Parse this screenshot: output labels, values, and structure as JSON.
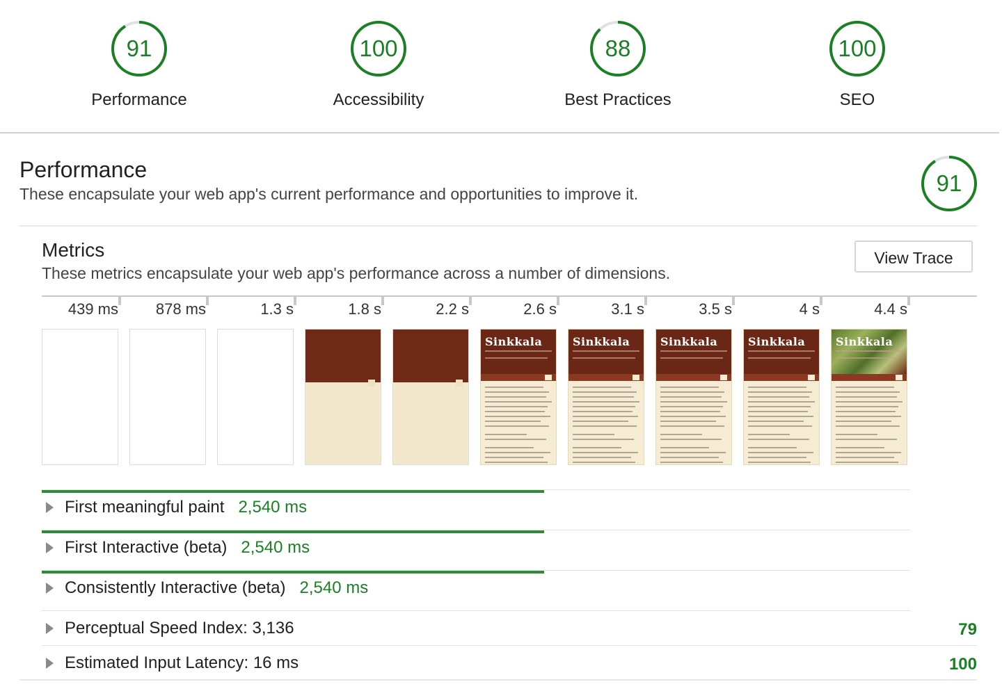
{
  "scores": [
    {
      "value": "91",
      "label": "Performance",
      "fraction": 0.91
    },
    {
      "value": "100",
      "label": "Accessibility",
      "fraction": 1.0
    },
    {
      "value": "88",
      "label": "Best Practices",
      "fraction": 0.88
    },
    {
      "value": "100",
      "label": "SEO",
      "fraction": 1.0
    }
  ],
  "performance": {
    "title": "Performance",
    "description": "These encapsulate your web app's current performance and opportunities to improve it.",
    "score": "91",
    "score_fraction": 0.91
  },
  "metrics": {
    "title": "Metrics",
    "description": "These metrics encapsulate your web app's performance across a number of dimensions.",
    "view_trace_label": "View Trace"
  },
  "filmstrip": {
    "ticks": [
      "439 ms",
      "878 ms",
      "1.3 s",
      "1.8 s",
      "2.2 s",
      "2.6 s",
      "3.1 s",
      "3.5 s",
      "4 s",
      "4.4 s"
    ],
    "frames": [
      "blank",
      "blank",
      "blank",
      "brown",
      "brown",
      "site",
      "site",
      "site",
      "site",
      "site-photo"
    ],
    "site_title": "Sinkkala"
  },
  "rows": [
    {
      "label": "First meaningful paint",
      "value": "2,540 ms",
      "has_bar": true,
      "score": ""
    },
    {
      "label": "First Interactive (beta)",
      "value": "2,540 ms",
      "has_bar": true,
      "score": ""
    },
    {
      "label": "Consistently Interactive (beta)",
      "value": "2,540 ms",
      "has_bar": true,
      "score": ""
    },
    {
      "label": "Perceptual Speed Index: 3,136",
      "value": "",
      "has_bar": false,
      "score": "79"
    },
    {
      "label": "Estimated Input Latency: 16 ms",
      "value": "",
      "has_bar": false,
      "score": "100"
    }
  ],
  "colors": {
    "pass": "#1b7f24",
    "gauge_track": "#e0e0e0",
    "bar": "#2e8b35"
  }
}
